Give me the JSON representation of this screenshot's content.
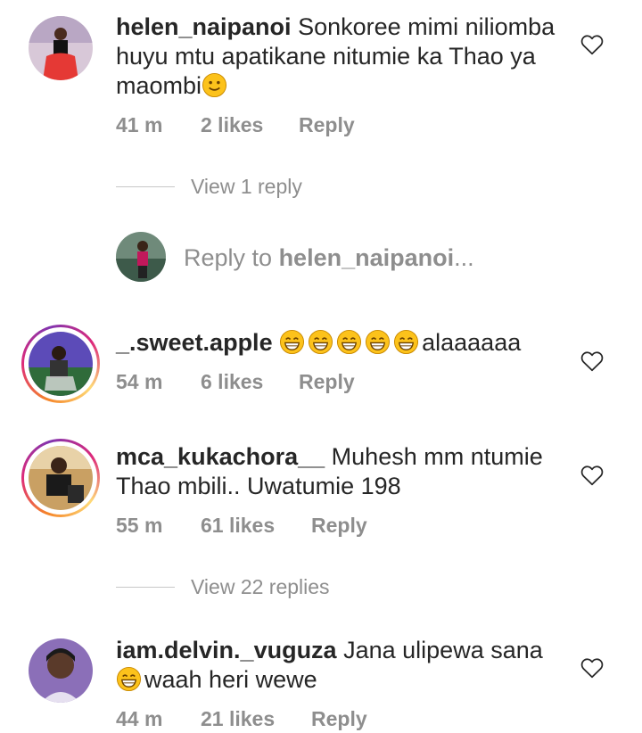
{
  "comments": [
    {
      "username": "helen_naipanoi",
      "text_parts": [
        "Sonkoree mimi niliomba huyu mtu apatikane nitumie ka Thao ya maombi"
      ],
      "time": "41 m",
      "likes": "2 likes",
      "reply_label": "Reply",
      "view_replies": "View 1 reply",
      "avatar_color": "#e53935"
    },
    {
      "username": "_.sweet.apple",
      "text_parts": [
        "alaaaaaa"
      ],
      "time": "54 m",
      "likes": "6 likes",
      "reply_label": "Reply",
      "avatar_color": "#5c4bb8"
    },
    {
      "username": "mca_kukachora__",
      "text_parts": [
        "Muhesh mm ntumie Thao mbili.. Uwatumie 198"
      ],
      "time": "55 m",
      "likes": "61 likes",
      "reply_label": "Reply",
      "view_replies": "View 22 replies",
      "avatar_color": "#c9a063"
    },
    {
      "username": "iam.delvin._vuguza",
      "text_parts": [
        "Jana ulipewa sana",
        "waah heri wewe"
      ],
      "time": "44 m",
      "likes": "21 likes",
      "reply_label": "Reply",
      "avatar_color": "#8b6fb8"
    }
  ],
  "reply_composer": {
    "prefix": "Reply to ",
    "target": "helen_naipanoi",
    "ellipsis": "..."
  },
  "colors": {
    "text": "#262626",
    "secondary": "#8e8e8e",
    "story_ring": "#dd2a7b"
  },
  "icons": [
    "heart-icon",
    "grinning-emoji-icon",
    "smiling-emoji-icon"
  ]
}
